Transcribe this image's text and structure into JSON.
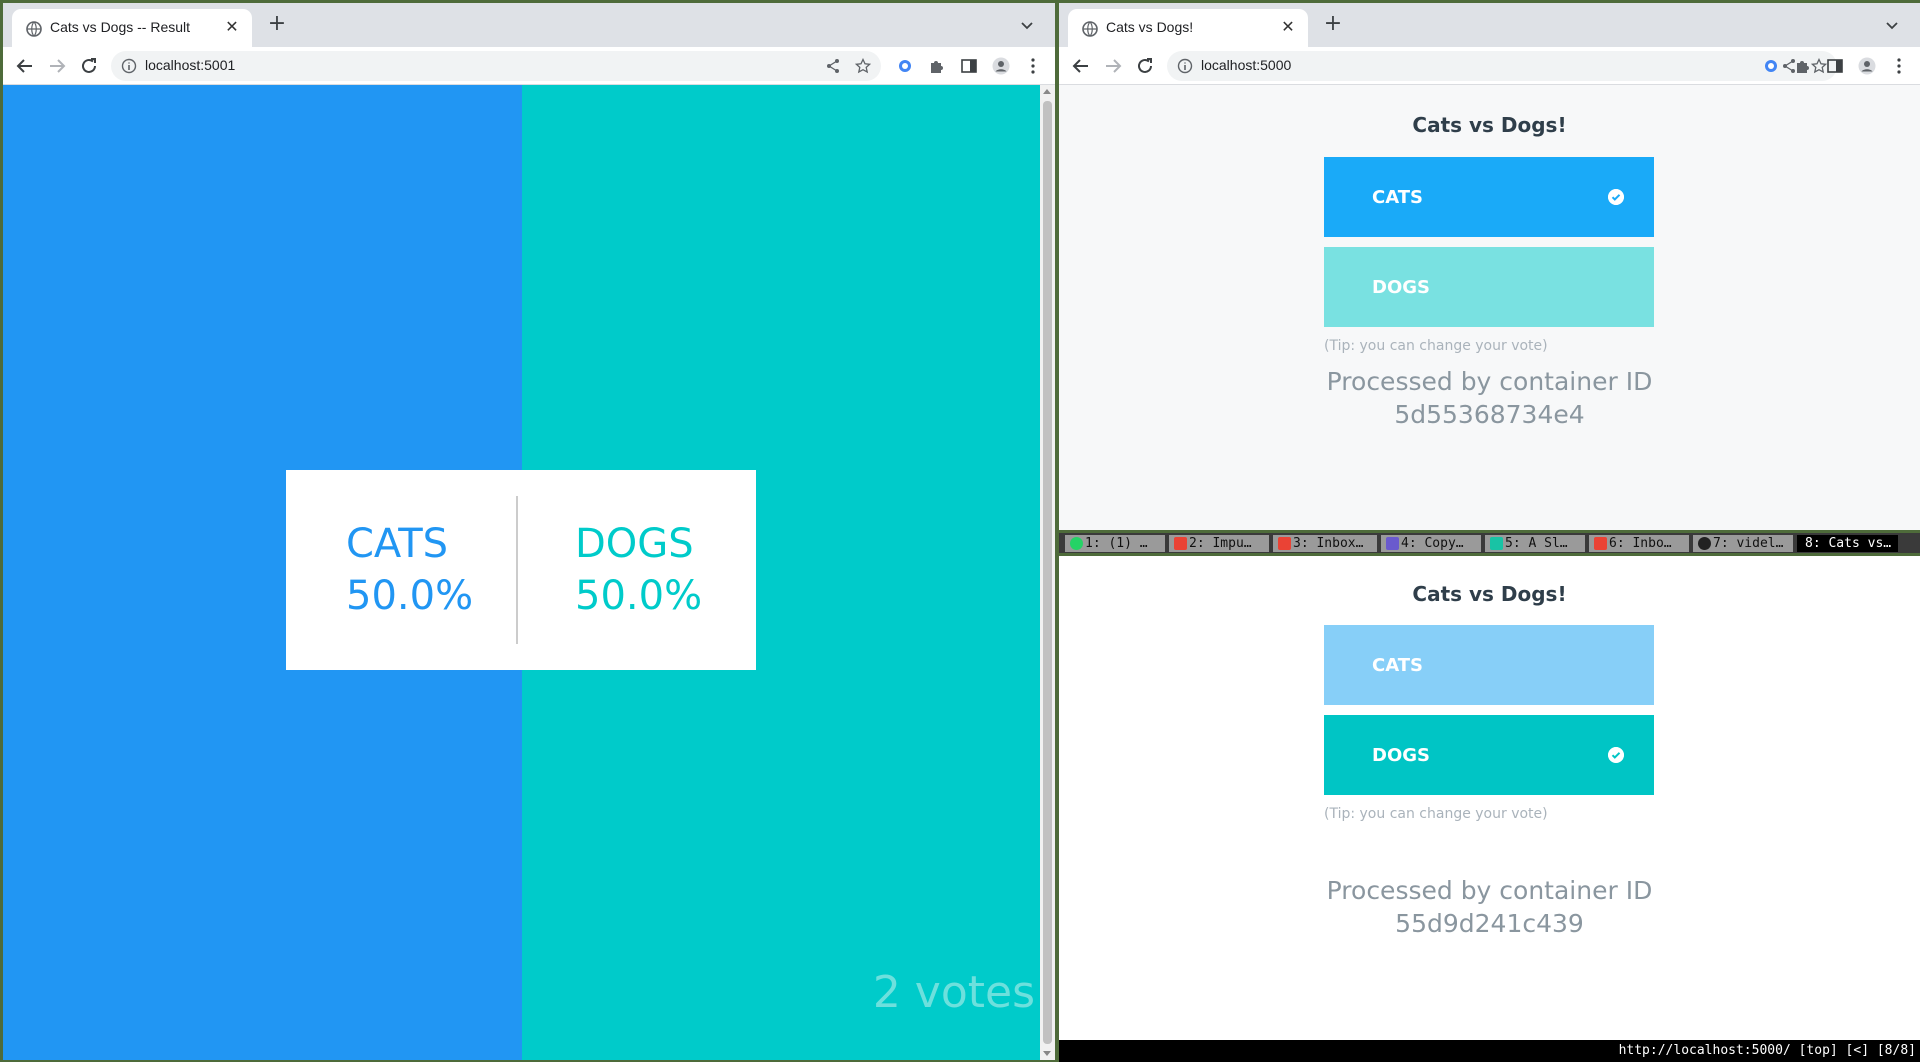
{
  "left_window": {
    "tab_title": "Cats vs Dogs -- Result",
    "url": "localhost:5001",
    "result": {
      "cats_label": "CATS",
      "cats_pct": "50.0%",
      "dogs_label": "DOGS",
      "dogs_pct": "50.0%",
      "cats_share": 0.5,
      "votes": "2 votes"
    }
  },
  "right_top_window": {
    "tab_title": "Cats vs Dogs!",
    "url": "localhost:5000",
    "title": "Cats vs Dogs!",
    "cats_label": "CATS",
    "dogs_label": "DOGS",
    "selected": "cats",
    "tip": "(Tip: you can change your vote)",
    "processed_label": "Processed by container ID",
    "container_id": "5d55368734e4"
  },
  "right_bottom_window": {
    "title": "Cats vs Dogs!",
    "cats_label": "CATS",
    "dogs_label": "DOGS",
    "selected": "dogs",
    "tip": "(Tip: you can change your vote)",
    "processed_label": "Processed by container ID",
    "container_id": "55d9d241c439"
  },
  "tabbar": {
    "items": [
      {
        "label": "1: (1) …",
        "icon": "whatsapp-icon"
      },
      {
        "label": "2: Impu…",
        "icon": "gmail-icon"
      },
      {
        "label": "3: Inbox…",
        "icon": "gmail-icon"
      },
      {
        "label": "4: Copy…",
        "icon": "list-icon"
      },
      {
        "label": "5: A Sl…",
        "icon": "app-icon"
      },
      {
        "label": "6: Inbo…",
        "icon": "gmail-icon"
      },
      {
        "label": "7: videl…",
        "icon": "github-icon"
      },
      {
        "label": "8: Cats vs…",
        "icon": "none",
        "active": true
      }
    ]
  },
  "statusline": "http://localhost:5000/ [top] [<] [8/8]",
  "colors": {
    "cats": "#2196f3",
    "dogs": "#00cbca",
    "cats_btn_active": "#1aaaf8",
    "cats_btn_inactive": "#87cff8",
    "dogs_btn_active": "#00c5c5",
    "dogs_btn_inactive": "#79e1e1"
  }
}
